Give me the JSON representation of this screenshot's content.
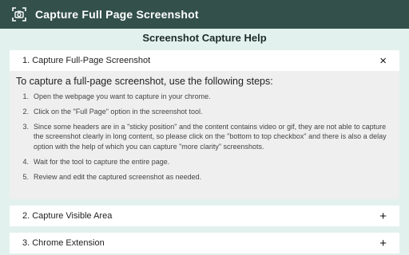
{
  "header": {
    "title": "Capture Full Page Screenshot",
    "logo_icon": "camera-icon"
  },
  "help_title": "Screenshot Capture Help",
  "sections": [
    {
      "label": "1. Capture Full-Page Screenshot",
      "toggle": "×",
      "expanded": true,
      "intro": "To capture a full-page screenshot, use the following steps:",
      "steps": [
        {
          "num": "1.",
          "text": "Open the webpage you want to capture in your chrome."
        },
        {
          "num": "2.",
          "text": "Click on the \"Full Page\" option in the screenshot tool."
        },
        {
          "num": "3.",
          "text": "Since some headers are in a \"sticky position\" and the content contains video or gif, they are not able to capture the screenshot clearly in long content, so please click on the \"bottom to top checkbox\" and there is also a delay option with the help of which you can capture \"more clarity\" screenshots."
        },
        {
          "num": "4.",
          "text": "Wait for the tool to capture the entire page."
        },
        {
          "num": "5.",
          "text": "Review and edit the captured screenshot as needed."
        }
      ]
    },
    {
      "label": "2. Capture Visible Area",
      "toggle": "+",
      "expanded": false
    },
    {
      "label": "3. Chrome Extension",
      "toggle": "+",
      "expanded": false
    }
  ],
  "colors": {
    "header_bg": "#33504b",
    "page_bg": "#e2f1ee",
    "section_header_bg": "#ffffff",
    "section_body_bg": "#efefef"
  }
}
